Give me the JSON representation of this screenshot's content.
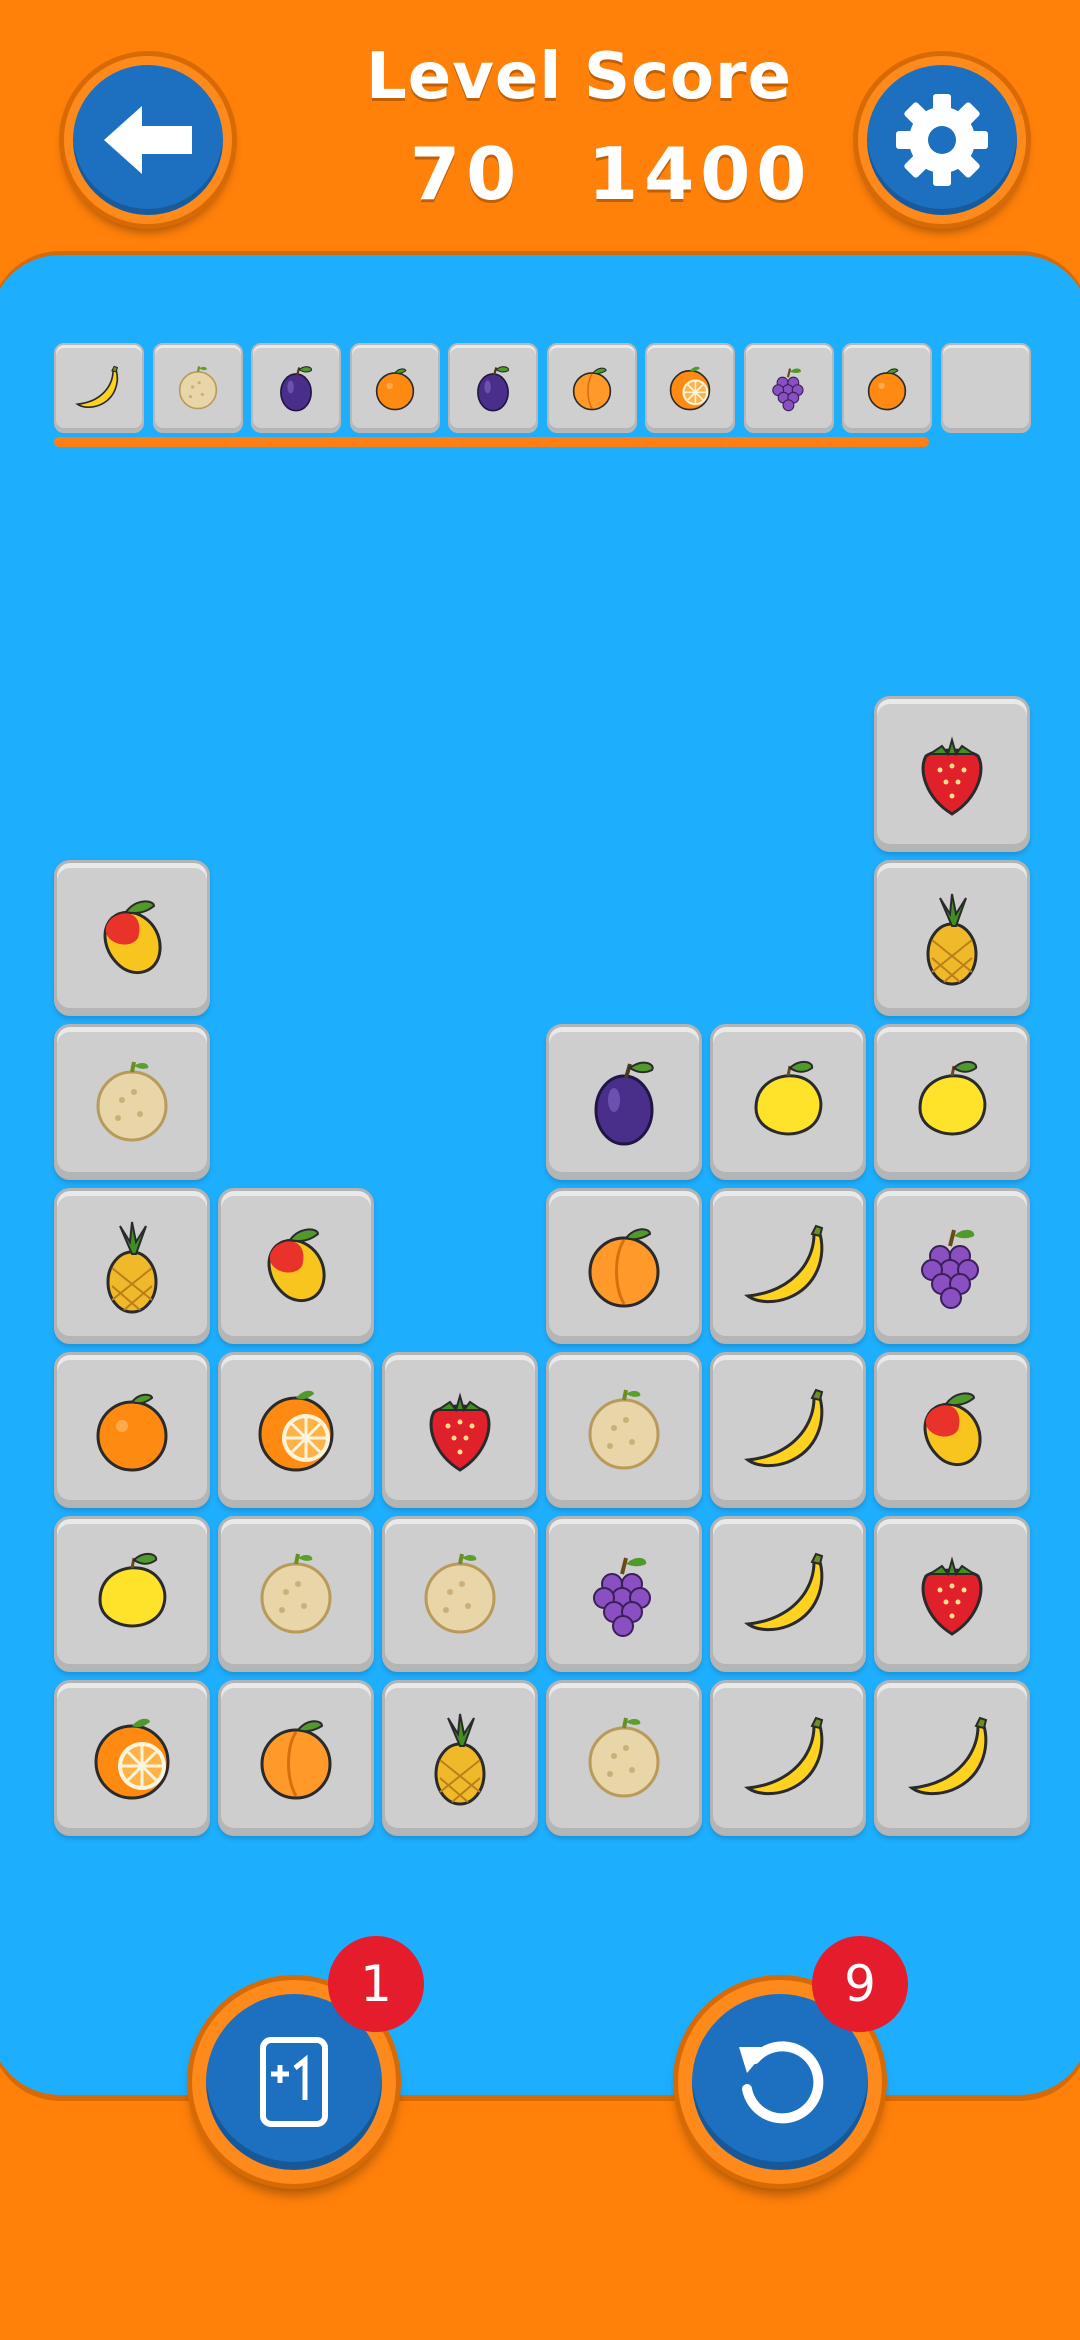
{
  "header": {
    "level_label": "Level",
    "level_value": "70",
    "score_label": "Score",
    "score_value": "1400",
    "back_icon": "arrow-left-icon",
    "settings_icon": "gear-icon"
  },
  "colors": {
    "frame_orange": "#ff810a",
    "board_blue": "#1eaefe",
    "button_blue": "#1d6fc0",
    "tile_grey": "#cecece",
    "badge_red": "#e41c2c"
  },
  "tray": {
    "capacity": 10,
    "slots": [
      "banana",
      "melon",
      "plum",
      "orange",
      "plum",
      "apricot",
      "orange-slice",
      "grapes",
      "orange",
      ""
    ]
  },
  "board": {
    "columns": 6,
    "rows": 7,
    "grid": [
      [
        "",
        "",
        "",
        "",
        "",
        "strawberry"
      ],
      [
        "mango",
        "",
        "",
        "",
        "",
        "pineapple"
      ],
      [
        "melon",
        "",
        "",
        "plum",
        "lemon",
        "lemon"
      ],
      [
        "pineapple",
        "mango",
        "",
        "apricot",
        "banana",
        "grapes"
      ],
      [
        "orange",
        "orange-slice",
        "strawberry",
        "melon",
        "banana",
        "mango"
      ],
      [
        "lemon",
        "melon",
        "melon",
        "grapes",
        "banana",
        "strawberry"
      ],
      [
        "orange-slice",
        "apricot",
        "pineapple",
        "melon",
        "banana",
        "banana"
      ]
    ]
  },
  "boosters": {
    "add_slot": {
      "icon": "plus-one-card-icon",
      "count": "1"
    },
    "undo": {
      "icon": "undo-icon",
      "count": "9"
    }
  }
}
